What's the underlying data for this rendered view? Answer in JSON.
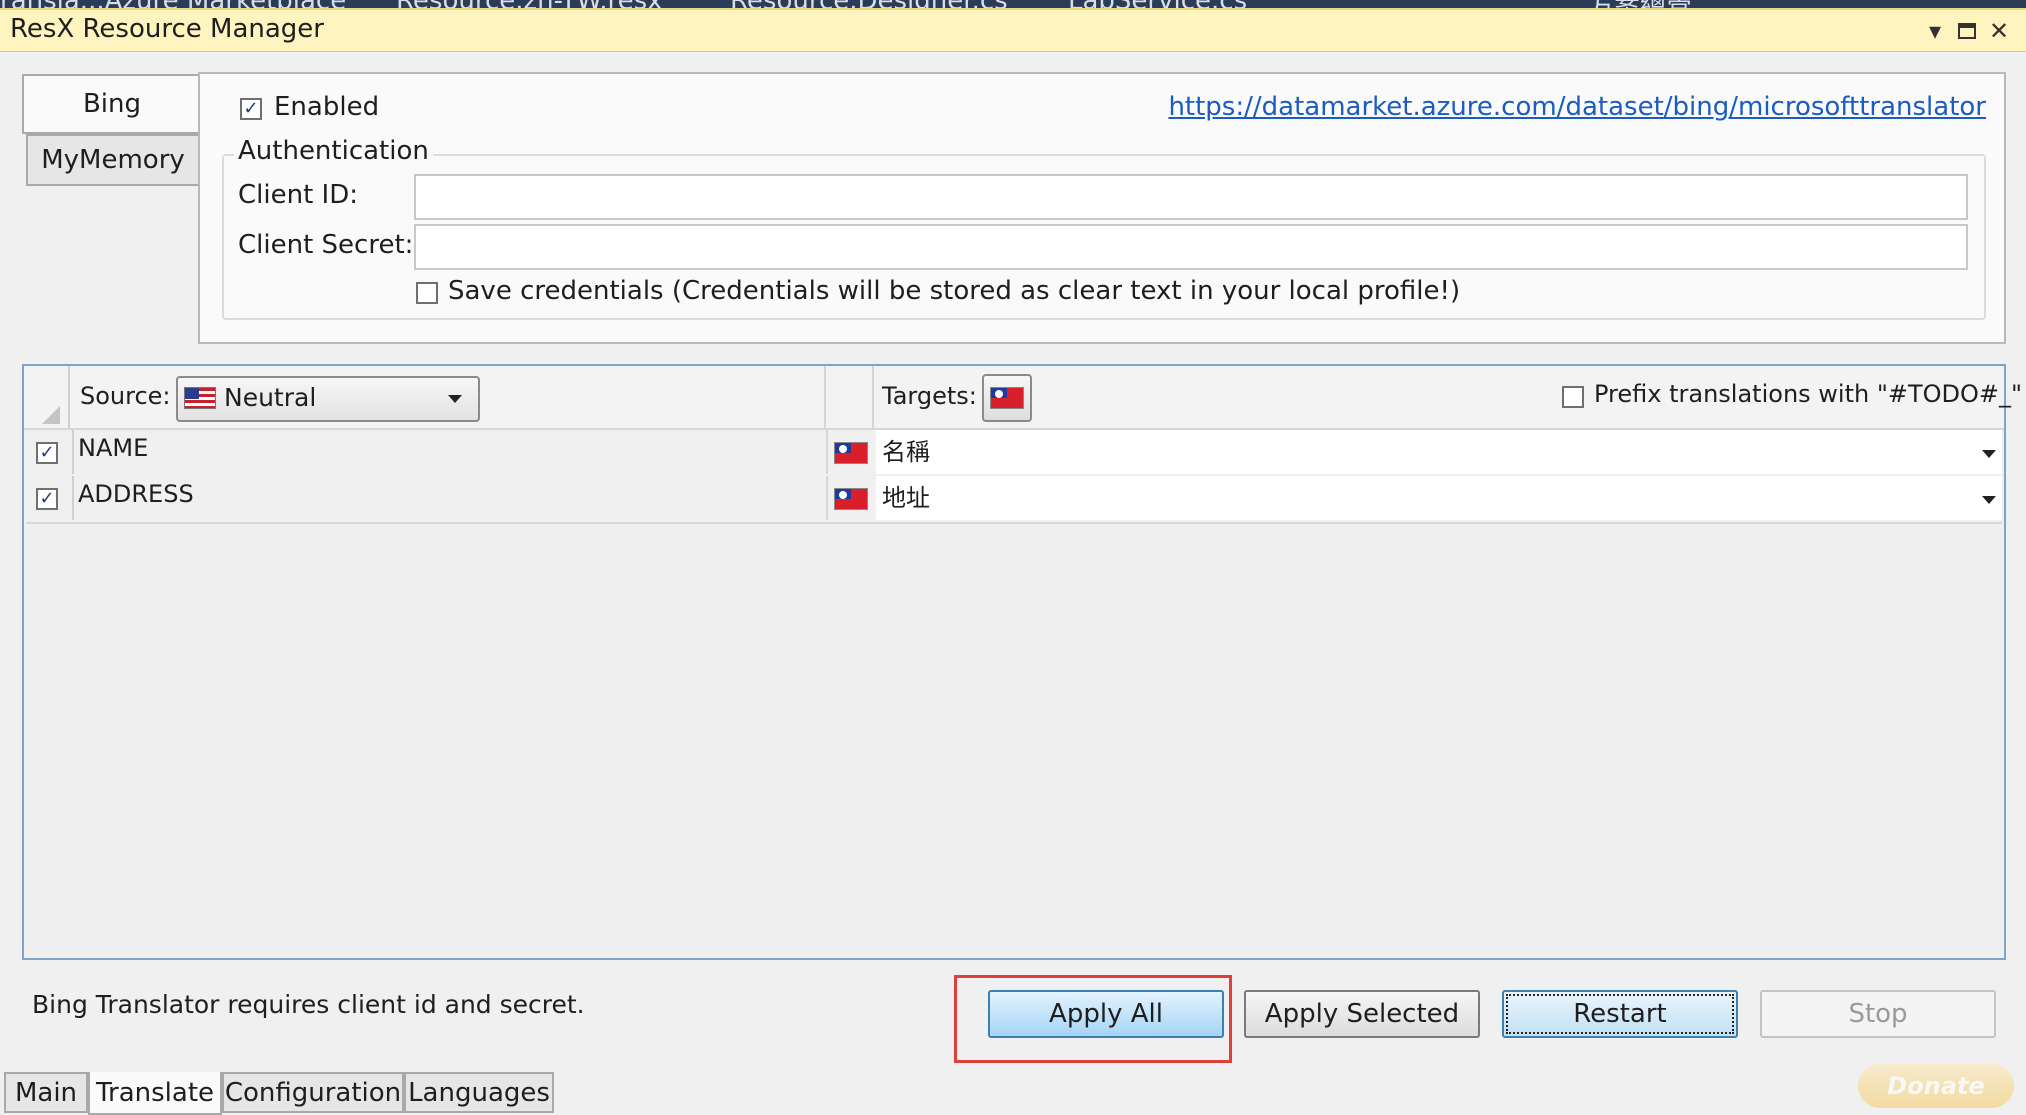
{
  "doc_tabs": [
    "ransla...Azure Marketplace",
    "Resource.zh-TW.resx",
    "Resource.Designer.cs",
    "LabService.cs",
    "方案總管"
  ],
  "window": {
    "title": "ResX Resource Manager"
  },
  "providers": {
    "tabs": [
      "Bing",
      "MyMemory"
    ],
    "active": "Bing",
    "bing": {
      "enabled_label": "Enabled",
      "enabled": true,
      "link": "https://datamarket.azure.com/dataset/bing/microsofttranslator",
      "group_title": "Authentication",
      "client_id_label": "Client ID:",
      "client_id_value": "",
      "client_secret_label": "Client Secret:",
      "client_secret_value": "",
      "save_credentials_label": "Save credentials (Credentials will be stored as clear text in your local profile!)",
      "save_credentials": false
    }
  },
  "grid": {
    "source_label": "Source:",
    "source_value": "Neutral",
    "targets_label": "Targets:",
    "prefix_label": "Prefix translations with \"#TODO#_\"",
    "prefix_checked": false,
    "rows": [
      {
        "key": "NAME",
        "translation": "名稱",
        "checked": true
      },
      {
        "key": "ADDRESS",
        "translation": "地址",
        "checked": true
      }
    ]
  },
  "status": {
    "message": "Bing Translator requires client id and secret."
  },
  "buttons": {
    "apply_all": "Apply All",
    "apply_selected": "Apply Selected",
    "restart": "Restart",
    "stop": "Stop"
  },
  "bottom_tabs": [
    "Main",
    "Translate",
    "Configuration",
    "Languages"
  ],
  "active_bottom_tab": "Translate",
  "donate": "Donate",
  "colors": {
    "titlebar": "#fdf4bf",
    "grid_border": "#7fa4c9",
    "highlight": "#e0403c",
    "primary_button": "#a6d4f4"
  }
}
